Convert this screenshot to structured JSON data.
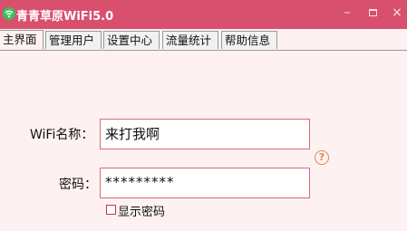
{
  "window": {
    "title": "青青草原WiFi5.0",
    "app_icon": "wifi-icon",
    "title_bar_color": "#d8506e",
    "controls": {
      "minimize": "minimize-icon",
      "maximize": "maximize-icon",
      "close_glyph": "×"
    }
  },
  "tabs": [
    {
      "label": "主界面",
      "active": true
    },
    {
      "label": "管理用户",
      "active": false
    },
    {
      "label": "设置中心",
      "active": false
    },
    {
      "label": "流量统计",
      "active": false
    },
    {
      "label": "帮助信息",
      "active": false
    }
  ],
  "form": {
    "ssid_label": "WiFi名称：",
    "ssid_value": "来打我啊",
    "password_label": "密码：",
    "password_value": "*********",
    "help_glyph": "?",
    "help_icon": "help-icon",
    "show_password_label": "显示密码",
    "show_password_checked": false
  }
}
